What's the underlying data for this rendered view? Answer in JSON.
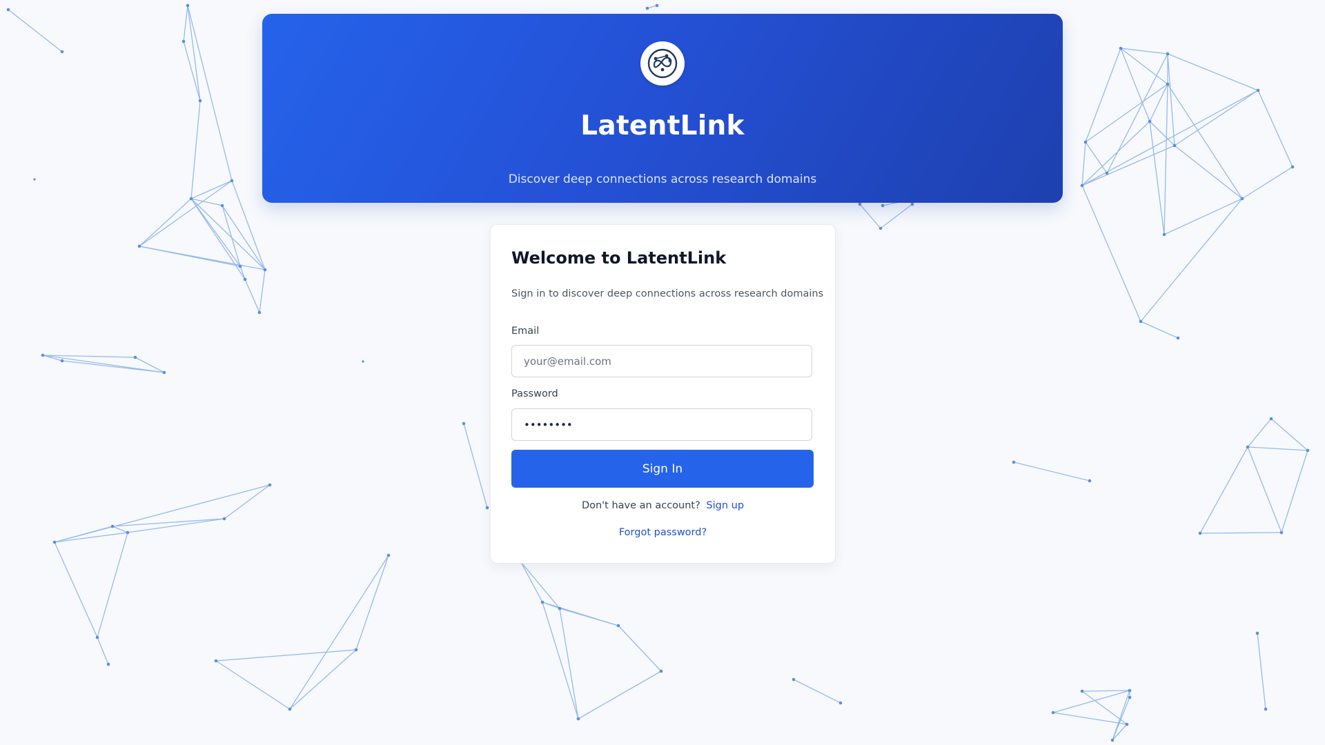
{
  "brand": {
    "name": "LatentLink",
    "tagline": "Discover deep connections across research domains",
    "logo_icon": "network-infinity-icon"
  },
  "login": {
    "title": "Welcome to LatentLink",
    "subtitle": "Sign in to discover deep connections across research domains",
    "email_label": "Email",
    "email_placeholder": "your@email.com",
    "email_value": "",
    "password_label": "Password",
    "password_value": "password",
    "submit_label": "Sign In",
    "no_account_text": "Don't have an account?",
    "signup_link": "Sign up",
    "forgot_link": "Forgot password?"
  },
  "colors": {
    "primary": "#2563eb",
    "header_gradient_end": "#1e40af",
    "background": "#f7f9fc",
    "network_line": "#7fa8ea"
  }
}
